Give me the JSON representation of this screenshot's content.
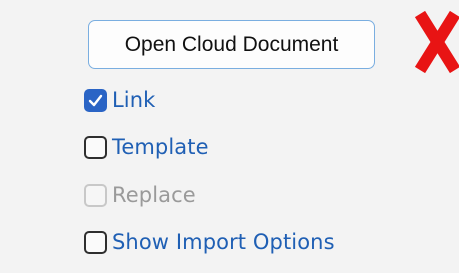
{
  "open_cloud_button": {
    "label": "Open Cloud Document"
  },
  "close_icon": {
    "name": "close-icon",
    "color": "#e81414"
  },
  "options": [
    {
      "label": "Link",
      "checked": true,
      "enabled": true
    },
    {
      "label": "Template",
      "checked": false,
      "enabled": true
    },
    {
      "label": "Replace",
      "checked": false,
      "enabled": false
    },
    {
      "label": "Show Import Options",
      "checked": false,
      "enabled": true
    }
  ],
  "colors": {
    "accent": "#2a64c5",
    "label_link": "#1f5fb4",
    "label_disabled": "#9a9a9a",
    "button_border": "#7aaee0",
    "background": "#f3f3f3"
  }
}
